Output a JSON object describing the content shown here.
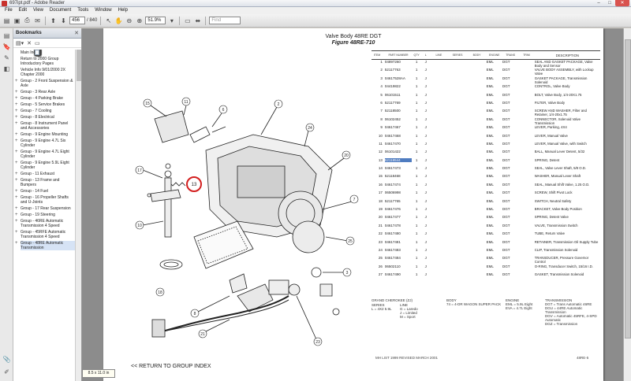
{
  "window": {
    "title": "697ipt.pdf - Adobe Reader",
    "minimize": "–",
    "maximize": "□",
    "close": "✕"
  },
  "menu": [
    "File",
    "Edit",
    "View",
    "Document",
    "Tools",
    "Window",
    "Help"
  ],
  "toolbar": {
    "page_current": "456",
    "page_total": "/ 840",
    "zoom": "51.9%",
    "find_placeholder": "Find"
  },
  "bookmarks": {
    "title": "Bookmarks",
    "items": [
      {
        "plus": "",
        "label": "Main Index"
      },
      {
        "plus": "",
        "label": "Return to 2000 Group Introductory Pages"
      },
      {
        "plus": "",
        "label": "Vehicle Info 9/01/2000 2X Chapter 2000"
      },
      {
        "plus": "+",
        "label": "Group - 2 Front Suspension & Axle"
      },
      {
        "plus": "+",
        "label": "Group - 3 Rear Axle"
      },
      {
        "plus": "+",
        "label": "Group - 4 Parking Brake"
      },
      {
        "plus": "+",
        "label": "Group - 5 Service Brakes"
      },
      {
        "plus": "+",
        "label": "Group - 7 Cooling"
      },
      {
        "plus": "+",
        "label": "Group - 8 Electrical"
      },
      {
        "plus": "+",
        "label": "Group - 8 Instrument Panel and Accessories"
      },
      {
        "plus": "+",
        "label": "Group - 9 Engine Mounting"
      },
      {
        "plus": "+",
        "label": "Group - 9 Engine 4.7L Six Cylinder"
      },
      {
        "plus": "+",
        "label": "Group - 9 Engine 4.7L Eight Cylinder"
      },
      {
        "plus": "+",
        "label": "Group - 9 Engine 5.9L Eight Cylinder"
      },
      {
        "plus": "+",
        "label": "Group - 11 Exhaust"
      },
      {
        "plus": "+",
        "label": "Group - 13 Frame and Bumpers"
      },
      {
        "plus": "+",
        "label": "Group - 14 Fuel"
      },
      {
        "plus": "+",
        "label": "Group - 16 Propeller Shafts and U-Joints"
      },
      {
        "plus": "+",
        "label": "Group - 17 Rear Suspension"
      },
      {
        "plus": "+",
        "label": "Group - 19 Steering"
      },
      {
        "plus": "+",
        "label": "Group - 46RE Automatic Transmission 4 Speed"
      },
      {
        "plus": "+",
        "label": "Group - 45RFE Automatic Transmission 4 Speed"
      },
      {
        "plus": "+",
        "label": "Group - 48RE Automatic Transmission"
      }
    ]
  },
  "page": {
    "title_line1": "Valve Body 48RE DGT",
    "title_line2": "Figure 48RE-710",
    "columns": [
      "ITEM",
      "PART NUMBER",
      "QTY",
      "L",
      "LINE",
      "SERIES",
      "BODY",
      "ENGINE",
      "TRANS",
      "TRIM",
      "DESCRIPTION"
    ],
    "rows": [
      {
        "item": "1",
        "part": "04897260",
        "qty": "1",
        "l": "J",
        "engine": "EML",
        "trans": "DGT",
        "desc": "SEAL AND GASKET PACKAGE, Valve Body and Sensor"
      },
      {
        "item": "2",
        "part": "52117763",
        "qty": "1",
        "l": "J",
        "engine": "EML",
        "trans": "DGT",
        "desc": "VALVE BODY ASSEMBLY, with Lockup Valve"
      },
      {
        "item": "3",
        "part": "04617528AA",
        "qty": "1",
        "l": "J",
        "engine": "EML",
        "trans": "DGT",
        "desc": "GASKET PACKAGE, Transmission Solenoid"
      },
      {
        "item": "4",
        "part": "04419822",
        "qty": "1",
        "l": "J",
        "engine": "EML",
        "trans": "DGT",
        "desc": "CONTROL, Valve Body"
      },
      {
        "item": "5",
        "part": "06101511",
        "qty": "1",
        "l": "J",
        "engine": "EML",
        "trans": "DGT",
        "desc": "BOLT, Valve Body, 1/4-20X1.75"
      },
      {
        "item": "6",
        "part": "52117769",
        "qty": "1",
        "l": "J",
        "engine": "EML",
        "trans": "DGT",
        "desc": "FILTER, Valve Body"
      },
      {
        "item": "7",
        "part": "52118500",
        "qty": "1",
        "l": "J",
        "engine": "EML",
        "trans": "DGT",
        "desc": "SCREW AND WASHER, Filter and Retainer, 1/4-20x1.75"
      },
      {
        "item": "8",
        "part": "06102452",
        "qty": "1",
        "l": "J",
        "engine": "EML",
        "trans": "DGT",
        "desc": "CONNECTOR, Solenoid Valve Transmission"
      },
      {
        "item": "9",
        "part": "04617467",
        "qty": "1",
        "l": "J",
        "engine": "EML",
        "trans": "DGT",
        "desc": "LEVER, Parking, 4X4"
      },
      {
        "item": "10",
        "part": "04617468",
        "qty": "1",
        "l": "J",
        "engine": "EML",
        "trans": "DGT",
        "desc": "LEVER, Manual Valve"
      },
      {
        "item": "11",
        "part": "04617470",
        "qty": "1",
        "l": "J",
        "engine": "EML",
        "trans": "DGT",
        "desc": "LEVER, Manual Valve, with Switch"
      },
      {
        "item": "12",
        "part": "06101422",
        "qty": "1",
        "l": "J",
        "engine": "EML",
        "trans": "DGT",
        "desc": "BALL, Manual Lever Detent, 5/32"
      },
      {
        "item": "13",
        "part": "52118544",
        "qty": "1",
        "l": "J",
        "engine": "EML",
        "trans": "DGT",
        "desc": "SPRING, Detent",
        "hl": true
      },
      {
        "item": "14",
        "part": "04617473",
        "qty": "1",
        "l": "J",
        "engine": "EML",
        "trans": "DGT",
        "desc": "SEAL, Valve Lever Shaft, 5/8 O.D."
      },
      {
        "item": "15",
        "part": "52118468",
        "qty": "1",
        "l": "J",
        "engine": "EML",
        "trans": "DGT",
        "desc": "WASHER, Manual Lever Shaft"
      },
      {
        "item": "16",
        "part": "04617474",
        "qty": "1",
        "l": "J",
        "engine": "EML",
        "trans": "DGT",
        "desc": "SEAL, Manual Shift Valve, 1.25 O.D."
      },
      {
        "item": "17",
        "part": "06506998",
        "qty": "1",
        "l": "J",
        "engine": "EML",
        "trans": "DGT",
        "desc": "SCREW, Shift Pivot Lock"
      },
      {
        "item": "18",
        "part": "52117765",
        "qty": "1",
        "l": "J",
        "engine": "EML",
        "trans": "DGT",
        "desc": "SWITCH, Neutral Safety"
      },
      {
        "item": "19",
        "part": "04617476",
        "qty": "1",
        "l": "J",
        "engine": "EML",
        "trans": "DGT",
        "desc": "BRACKET, Valve Body Position"
      },
      {
        "item": "20",
        "part": "04617477",
        "qty": "1",
        "l": "J",
        "engine": "EML",
        "trans": "DGT",
        "desc": "SPRING, Detent Valve"
      },
      {
        "item": "21",
        "part": "04617478",
        "qty": "1",
        "l": "J",
        "engine": "EML",
        "trans": "DGT",
        "desc": "VALVE, Transmission Switch"
      },
      {
        "item": "22",
        "part": "04617480",
        "qty": "1",
        "l": "J",
        "engine": "EML",
        "trans": "DGT",
        "desc": "TUBE, Return Valve"
      },
      {
        "item": "23",
        "part": "04617481",
        "qty": "1",
        "l": "J",
        "engine": "EML",
        "trans": "DGT",
        "desc": "RETAINER, Transmission Oil Supply Tube"
      },
      {
        "item": "24",
        "part": "04617483",
        "qty": "1",
        "l": "J",
        "engine": "EML",
        "trans": "DGT",
        "desc": "CLIP, Transmission Solenoid"
      },
      {
        "item": "25",
        "part": "04617484",
        "qty": "1",
        "l": "J",
        "engine": "EML",
        "trans": "DGT",
        "desc": "TRANSDUCER, Pressure Governor Control"
      },
      {
        "item": "26",
        "part": "06502110",
        "qty": "1",
        "l": "J",
        "engine": "EML",
        "trans": "DGT",
        "desc": "O-RING, Transducer Switch, 15/16 I.D."
      },
      {
        "item": "27",
        "part": "04617490",
        "qty": "1",
        "l": "J",
        "engine": "EML",
        "trans": "DGT",
        "desc": "GASKET, Transmission Solenoid"
      }
    ],
    "grand_codes": {
      "header": "GRAND CHEROKEE (ZJ)",
      "series": "SERIES\nL = 4X2 5.9L",
      "line": "LINE\nG = Laredo\nJ = Limited\nM = Sport",
      "body": "BODY\n74 = 4-DR WAGON SUPER PACK",
      "engine": "ENGINE\nEML = 5.9L Eight\nEVA = 4.7L Eight",
      "trans": "TRANSMISSION\nDGT = Trans Automatic 46RE\nDGU = 44RE Automatic Transmission\nDGV = Automatic 45RFE, 4-SPD Automatic\nDGZ = Transmission"
    },
    "foot_left": "MH   LIST 1999 REVISED MARCH 2001",
    "foot_right": "48RE-5",
    "return_link": "<< RETURN TO GROUP INDEX"
  },
  "statusbar": {
    "size": "8.5 x 11.0 in"
  }
}
